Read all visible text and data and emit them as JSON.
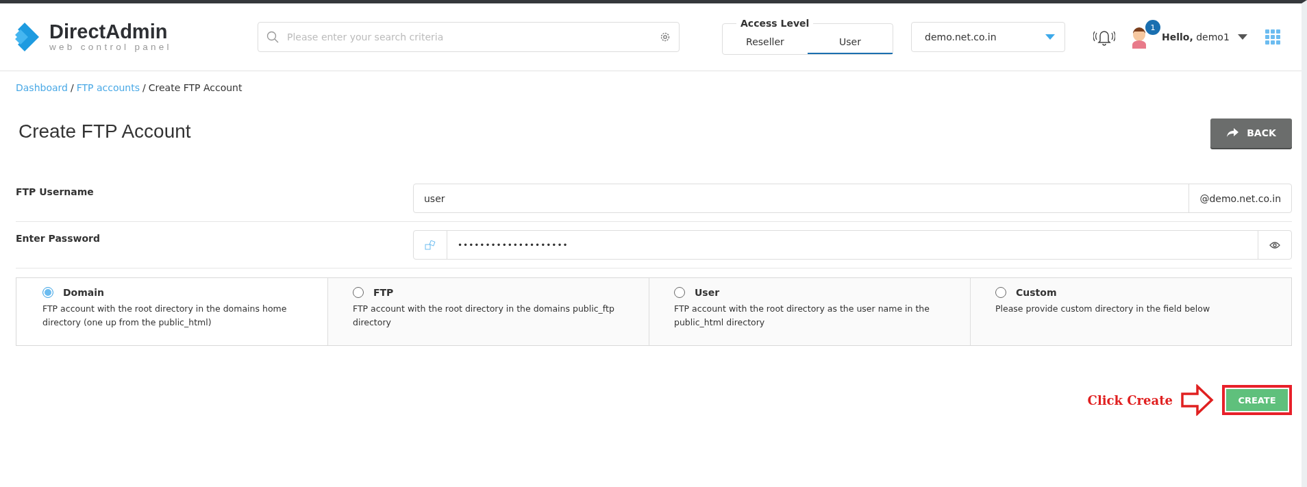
{
  "logo": {
    "name": "DirectAdmin",
    "tagline": "web control panel"
  },
  "search": {
    "placeholder": "Please enter your search criteria"
  },
  "access_level": {
    "label": "Access Level",
    "tabs": [
      {
        "label": "Reseller",
        "selected": false
      },
      {
        "label": "User",
        "selected": true
      }
    ]
  },
  "domain_select": {
    "value": "demo.net.co.in"
  },
  "notifications": {
    "count": "1"
  },
  "user": {
    "greeting": "Hello,",
    "name": "demo1"
  },
  "breadcrumb": [
    {
      "label": "Dashboard",
      "kind": "link"
    },
    {
      "separator": "/",
      "label": "FTP accounts",
      "kind": "link"
    },
    {
      "separator": "/",
      "label": "Create FTP Account",
      "kind": "current"
    }
  ],
  "title": "Create FTP Account",
  "back_button": "BACK",
  "fields": [
    {
      "label": "FTP Username",
      "kind": "text",
      "value": "user",
      "suffix": "@demo.net.co.in"
    },
    {
      "label": "Enter Password",
      "kind": "password",
      "value": "••••••••••••••••••••"
    }
  ],
  "directory_options": [
    {
      "label": "Domain",
      "description": "FTP account with the root directory in the domains home directory (one up from the public_html)",
      "selected": true
    },
    {
      "label": "FTP",
      "description": "FTP account with the root directory in the domains public_ftp directory",
      "selected": false
    },
    {
      "label": "User",
      "description": "FTP account with the root directory as the user name in the public_html directory",
      "selected": false
    },
    {
      "label": "Custom",
      "description": "Please provide custom directory in the field below",
      "selected": false
    }
  ],
  "annotation": "Click Create",
  "create_button": "CREATE"
}
